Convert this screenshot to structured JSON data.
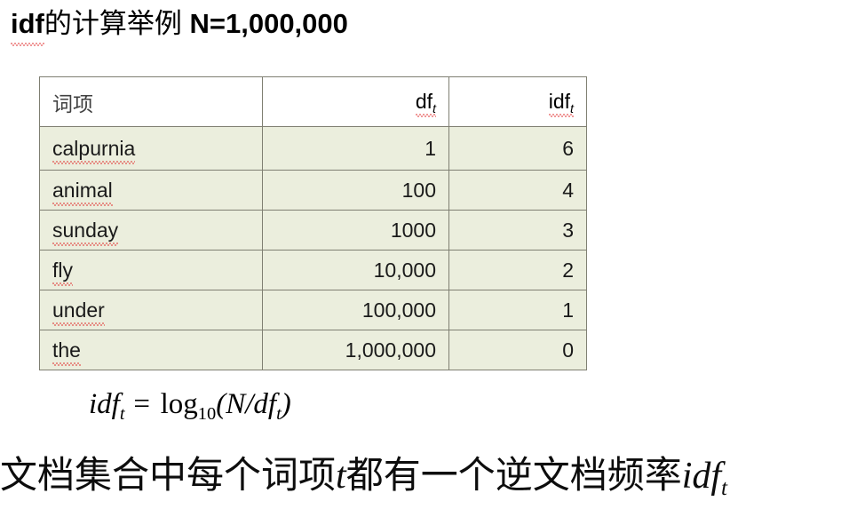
{
  "title": {
    "latin_prefix": "idf",
    "cjk": "的计算举例",
    "tail": " N=1,000,000"
  },
  "table": {
    "headers": {
      "term": "词项",
      "df_base": "df",
      "df_sub": "t",
      "idf_base": "idf",
      "idf_sub": "t"
    },
    "rows": [
      {
        "term": "calpurnia",
        "df": "1",
        "idf": "6"
      },
      {
        "term": "animal",
        "df": "100",
        "idf": "4"
      },
      {
        "term": "sunday",
        "df": "1000",
        "idf": "3"
      },
      {
        "term": "fly",
        "df": "10,000",
        "idf": "2"
      },
      {
        "term": "under",
        "df": "100,000",
        "idf": "1"
      },
      {
        "term": "the",
        "df": "1,000,000",
        "idf": "0"
      }
    ]
  },
  "formula": {
    "lhs_base": "idf",
    "lhs_sub": "t",
    "equals": " = ",
    "log": "log",
    "log_sub": "10",
    "open_paren": "(",
    "numerator": "N",
    "slash": "/",
    "denominator": "df",
    "denominator_sub": "t",
    "close_paren": ")"
  },
  "caption": {
    "part1": "文档集合中每个词项",
    "var1": "t",
    "part2": "都有一个逆文档频率",
    "var2": "idf",
    "var2_sub": "t"
  },
  "colors": {
    "table_body_bg": "#ebeedd",
    "table_header_bg": "#ffffff",
    "table_border": "#7f7f72",
    "spellcheck_underline": "#e03030",
    "text": "#000000",
    "page_bg": "#ffffff"
  }
}
